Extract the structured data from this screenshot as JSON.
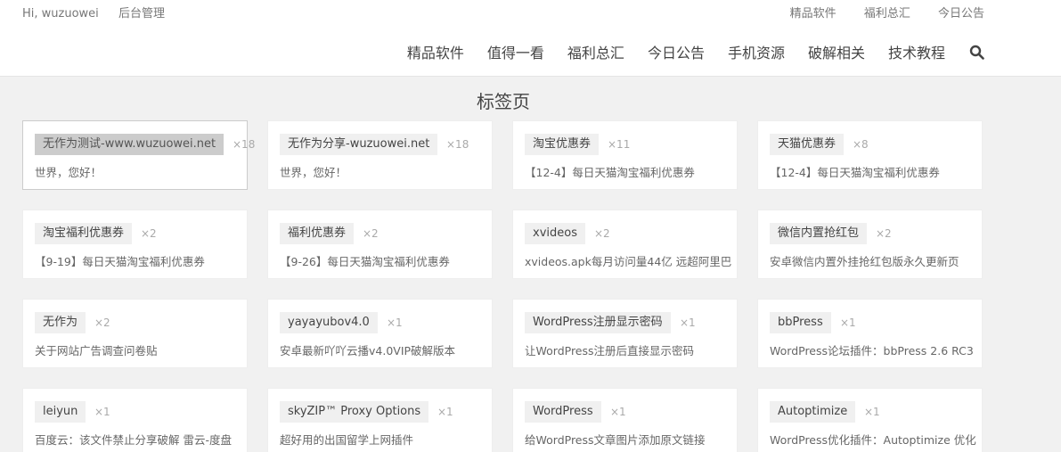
{
  "header": {
    "greeting": "Hi, wuzuowei",
    "admin": "后台管理",
    "top_links": [
      "精品软件",
      "福利总汇",
      "今日公告"
    ],
    "nav": [
      "精品软件",
      "值得一看",
      "福利总汇",
      "今日公告",
      "手机资源",
      "破解相关",
      "技术教程"
    ]
  },
  "page_title": "标签页",
  "cards": [
    {
      "tag": "无作为测试-www.wuzuowei.net",
      "count": "×18",
      "desc": "世界，您好！"
    },
    {
      "tag": "无作为分享-wuzuowei.net",
      "count": "×18",
      "desc": "世界，您好！"
    },
    {
      "tag": "淘宝优惠券",
      "count": "×11",
      "desc": "【12-4】每日天猫淘宝福利优惠券"
    },
    {
      "tag": "天猫优惠券",
      "count": "×8",
      "desc": "【12-4】每日天猫淘宝福利优惠券"
    },
    {
      "tag": "淘宝福利优惠券",
      "count": "×2",
      "desc": "【9-19】每日天猫淘宝福利优惠券"
    },
    {
      "tag": "福利优惠券",
      "count": "×2",
      "desc": "【9-26】每日天猫淘宝福利优惠券"
    },
    {
      "tag": "xvideos",
      "count": "×2",
      "desc": "xvideos.apk每月访问量44亿 远超阿里巴"
    },
    {
      "tag": "微信内置抢红包",
      "count": "×2",
      "desc": "安卓微信内置外挂抢红包版永久更新页"
    },
    {
      "tag": "无作为",
      "count": "×2",
      "desc": "关于网站广告调查问卷贴"
    },
    {
      "tag": "yayayubov4.0",
      "count": "×1",
      "desc": "安卓最新吖吖云播v4.0VIP破解版本"
    },
    {
      "tag": "WordPress注册显示密码",
      "count": "×1",
      "desc": "让WordPress注册后直接显示密码"
    },
    {
      "tag": "bbPress",
      "count": "×1",
      "desc": "WordPress论坛插件：bbPress 2.6 RC3"
    },
    {
      "tag": "leiyun",
      "count": "×1",
      "desc": "百度云：该文件禁止分享破解 雷云-度盘"
    },
    {
      "tag": "skyZIP™ Proxy Options",
      "count": "×1",
      "desc": "超好用的出国留学上网插件"
    },
    {
      "tag": "WordPress",
      "count": "×1",
      "desc": "给WordPress文章图片添加原文链接"
    },
    {
      "tag": "Autoptimize",
      "count": "×1",
      "desc": "WordPress优化插件：Autoptimize 优化"
    }
  ]
}
